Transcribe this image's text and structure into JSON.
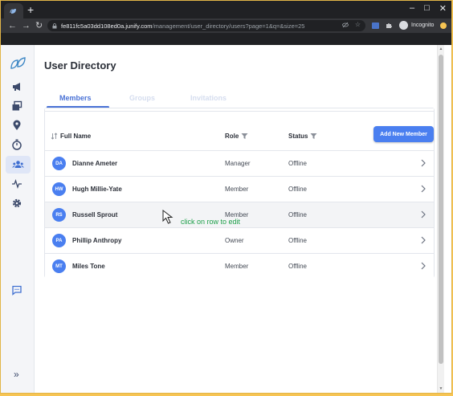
{
  "browser": {
    "new_tab": "+",
    "url_host": "fe811fc5a03dd108ed0a.junify.com",
    "url_path": "/management/user_directory/users?page=1&q=&size=25",
    "profile_label": "Incognito"
  },
  "page": {
    "title": "User Directory"
  },
  "tabs": [
    {
      "label": "Members"
    },
    {
      "label": "Groups"
    },
    {
      "label": "Invitations"
    }
  ],
  "table": {
    "headers": {
      "name": "Full Name",
      "role": "Role",
      "status": "Status"
    },
    "add_button": "Add New Member",
    "rows": [
      {
        "initials": "DA",
        "name": "Dianne Ameter",
        "role": "Manager",
        "status": "Offline"
      },
      {
        "initials": "HW",
        "name": "Hugh Millie-Yate",
        "role": "Member",
        "status": "Offline"
      },
      {
        "initials": "RS",
        "name": "Russell Sprout",
        "role": "Member",
        "status": "Offline"
      },
      {
        "initials": "PA",
        "name": "Phillip Anthropy",
        "role": "Owner",
        "status": "Offline"
      },
      {
        "initials": "MT",
        "name": "Miles Tone",
        "role": "Member",
        "status": "Offline"
      }
    ]
  },
  "annotation": {
    "hint": "click on row to edit"
  },
  "sidebar": {
    "icons": [
      "logo-icon",
      "megaphone-icon",
      "windows-icon",
      "location-pin-icon",
      "stopwatch-icon",
      "users-icon",
      "activity-icon",
      "gear-icon",
      "chat-icon",
      "chevron-double-right-icon"
    ],
    "collapse_label": "»"
  },
  "colors": {
    "accent": "#4a7ff0",
    "tab_active": "#4a72d6",
    "hint": "#1fa04a",
    "outer_border": "#f6c453"
  }
}
